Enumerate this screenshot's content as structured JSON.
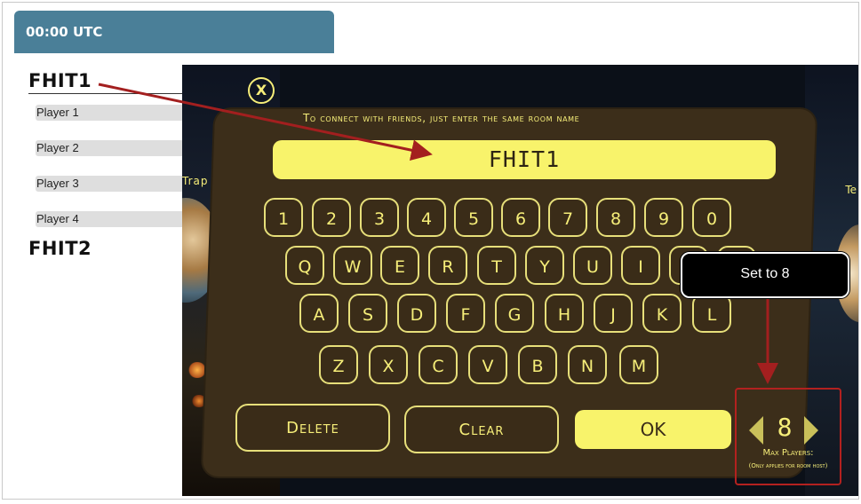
{
  "doc": {
    "time_header": "00:00 UTC",
    "room1_title": "FHIT1",
    "players": [
      "Player 1",
      "Player 2",
      "Player 3",
      "Player 4"
    ],
    "room2_title": "FHIT2"
  },
  "game": {
    "close_icon": "X",
    "left_label": "Trap",
    "right_label": "Te",
    "instruction": "To connect with friends, just enter the same room name",
    "room_name": "FHIT1",
    "keys_row1": [
      "1",
      "2",
      "3",
      "4",
      "5",
      "6",
      "7",
      "8",
      "9",
      "0"
    ],
    "keys_row2": [
      "Q",
      "W",
      "E",
      "R",
      "T",
      "Y",
      "U",
      "I"
    ],
    "keys_row3": [
      "A",
      "S",
      "D",
      "F",
      "G",
      "H",
      "J",
      "K",
      "L"
    ],
    "keys_row4": [
      "Z",
      "X",
      "C",
      "V",
      "B",
      "N",
      "M"
    ],
    "delete_label": "Delete",
    "clear_label": "Clear",
    "ok_label": "OK",
    "max_players_value": "8",
    "max_players_label": "Max Players:",
    "max_players_note": "(Only applies for room host)"
  },
  "callout": {
    "text": "Set to 8"
  },
  "colors": {
    "header_bg": "#4a7f98",
    "key_yellow": "#f6ee79",
    "input_yellow": "#f8f36b",
    "board_brown": "#3c2e1a",
    "annotation_red": "#a31f1f"
  }
}
